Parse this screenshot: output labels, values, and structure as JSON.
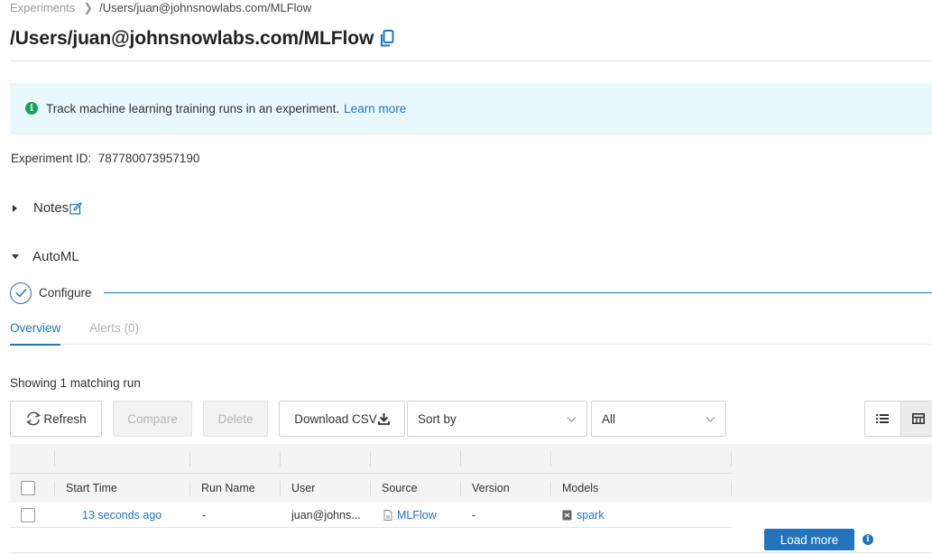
{
  "breadcrumb": {
    "root": "Experiments",
    "current": "/Users/juan@johnsnowlabs.com/MLFlow"
  },
  "header": {
    "title": "/Users/juan@johnsnowlabs.com/MLFlow",
    "copy_icon": "copy-icon"
  },
  "banner": {
    "icon": "info-icon",
    "text": "Track machine learning training runs in an experiment.",
    "link": "Learn more"
  },
  "experiment": {
    "id_label": "Experiment ID:",
    "id_value": "787780073957190"
  },
  "sections": {
    "notes": "Notes",
    "automl": "AutoML"
  },
  "automl": {
    "step_label": "Configure"
  },
  "tabs": [
    {
      "label": "Overview",
      "active": true
    },
    {
      "label": "Alerts (0)",
      "active": false
    }
  ],
  "runs": {
    "summary": "Showing 1 matching run"
  },
  "toolbar": {
    "refresh": "Refresh",
    "compare": "Compare",
    "delete": "Delete",
    "download_csv": "Download CSV",
    "sort_by": "Sort by",
    "filter": "All"
  },
  "table": {
    "columns": [
      "Start Time",
      "Run Name",
      "User",
      "Source",
      "Version",
      "Models"
    ],
    "rows": [
      {
        "start_time": "13 seconds ago",
        "run_name": "-",
        "user": "juan@johns...",
        "source": "MLFlow",
        "version": "-",
        "models": "spark"
      }
    ]
  },
  "footer": {
    "load_more": "Load more"
  },
  "colors": {
    "accent": "#2374bb",
    "banner_bg": "#e8f8fc",
    "info_green": "#18a35a"
  }
}
